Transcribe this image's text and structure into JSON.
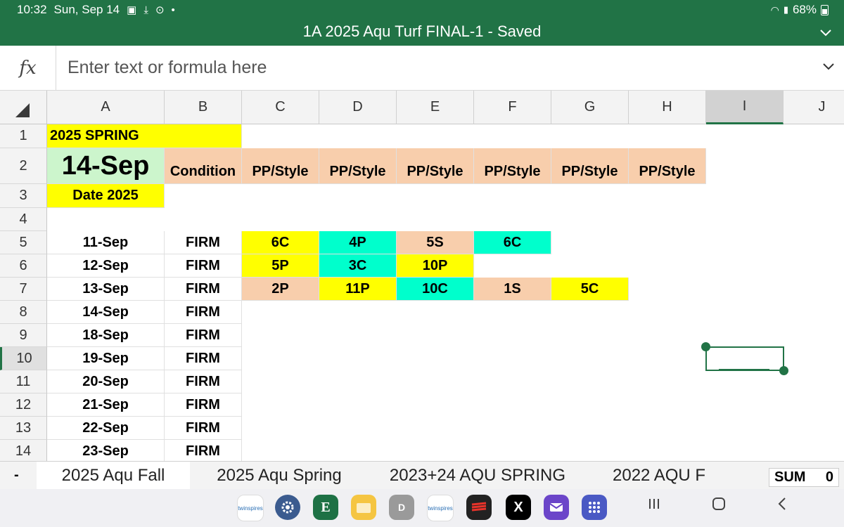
{
  "status": {
    "time": "10:32",
    "date": "Sun, Sep 14",
    "battery": "68%"
  },
  "title": "1A 2025 Aqu Turf FINAL-1 - Saved",
  "formula": {
    "fx_label": "fx",
    "placeholder": "Enter text or formula here"
  },
  "columns": [
    "A",
    "B",
    "C",
    "D",
    "E",
    "F",
    "G",
    "H",
    "I",
    "J"
  ],
  "rows": [
    "1",
    "2",
    "3",
    "4",
    "5",
    "6",
    "7",
    "8",
    "9",
    "10",
    "11",
    "12",
    "13",
    "14"
  ],
  "cells": {
    "a1": "2025 SPRING",
    "a2": "14-Sep",
    "a3": "Date 2025",
    "b2": "Condition",
    "c2": "PP/Style",
    "d2": "PP/Style",
    "e2": "PP/Style",
    "f2": "PP/Style",
    "g2": "PP/Style",
    "h2": "PP/Style",
    "a5": "11-Sep",
    "b5": "FIRM",
    "c5": "6C",
    "d5": "4P",
    "e5": "5S",
    "f5": "6C",
    "a6": "12-Sep",
    "b6": "FIRM",
    "c6": "5P",
    "d6": "3C",
    "e6": "10P",
    "a7": "13-Sep",
    "b7": "FIRM",
    "c7": "2P",
    "d7": "11P",
    "e7": "10C",
    "f7": "1S",
    "g7": "5C",
    "a8": "14-Sep",
    "b8": "FIRM",
    "a9": "18-Sep",
    "b9": "FIRM",
    "a10": "19-Sep",
    "b10": "FIRM",
    "a11": "20-Sep",
    "b11": "FIRM",
    "a12": "21-Sep",
    "b12": "FIRM",
    "a13": "22-Sep",
    "b13": "FIRM",
    "a14": "23-Sep",
    "b14": "FIRM"
  },
  "tabs": {
    "dash": "-",
    "items": [
      "2025 Aqu Fall",
      "2025 Aqu Spring",
      "2023+24 AQU SPRING",
      "2022 AQU F"
    ]
  },
  "sum": {
    "label": "SUM",
    "value": "0"
  },
  "dock": {
    "twinspires": "twinspires",
    "excel": "E",
    "d_app": "D",
    "x_app": "X"
  },
  "colors": {
    "excel_green": "#217346",
    "yellow": "#ffff00",
    "peach": "#f8ceac",
    "aqua": "#00ffcc",
    "mint": "#ccf5cc"
  }
}
